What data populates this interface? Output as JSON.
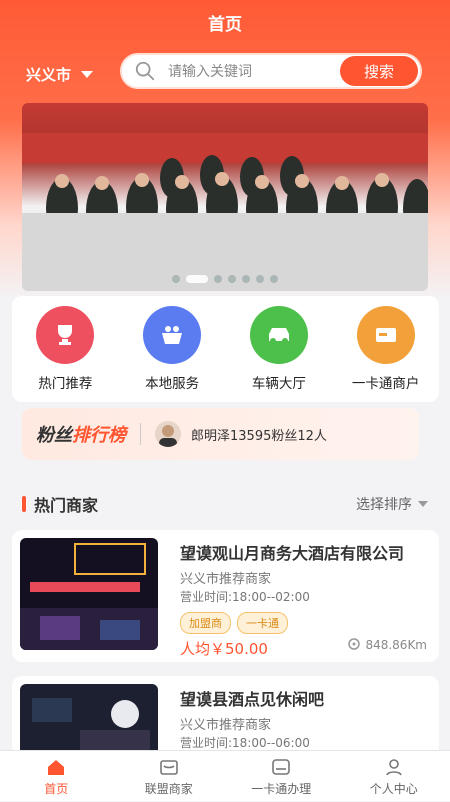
{
  "header": {
    "title": "首页",
    "city": "兴义市"
  },
  "search": {
    "placeholder": "请输入关键词",
    "button": "搜索"
  },
  "banner": {
    "slides": 7,
    "active": 1
  },
  "quick": [
    {
      "label": "热门推荐",
      "icon": "trophy-icon",
      "color": "#ee5060"
    },
    {
      "label": "本地服务",
      "icon": "basket-icon",
      "color": "#5a7cf0"
    },
    {
      "label": "车辆大厅",
      "icon": "car-icon",
      "color": "#4cc04a"
    },
    {
      "label": "一卡通商户",
      "icon": "card-icon",
      "color": "#f2a13a"
    }
  ],
  "fans": {
    "brand_a": "粉丝",
    "brand_b": "排行榜",
    "text": "郎明泽13595粉丝12人"
  },
  "section": {
    "title": "热门商家",
    "sort": "选择排序"
  },
  "merchants": [
    {
      "name": "望谟观山月商务大酒店有限公司",
      "sub": "兴义市推荐商家",
      "hours": "营业时间:18:00--02:00",
      "tags": [
        "加盟商",
        "一卡通"
      ],
      "price": "人均￥50.00",
      "distance": "848.86Km"
    },
    {
      "name": "望谟县酒点见休闲吧",
      "sub": "兴义市推荐商家",
      "hours": "营业时间:18:00--06:00",
      "tags": [],
      "price": "",
      "distance": ""
    }
  ],
  "tabs": [
    {
      "label": "首页",
      "icon": "home-icon",
      "active": true
    },
    {
      "label": "联盟商家",
      "icon": "shop-icon",
      "active": false
    },
    {
      "label": "一卡通办理",
      "icon": "wallet-icon",
      "active": false
    },
    {
      "label": "个人中心",
      "icon": "user-icon",
      "active": false
    }
  ]
}
